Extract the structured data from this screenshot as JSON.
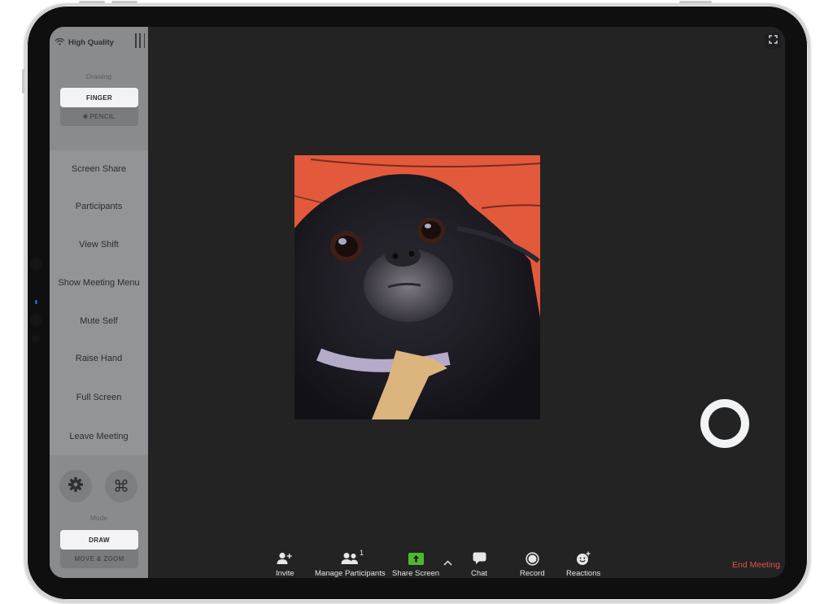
{
  "sidebar": {
    "connection": {
      "icon": "wifi-icon",
      "label": "High Quality"
    },
    "drawing": {
      "label": "Drawing",
      "options": [
        {
          "label": "FINGER",
          "selected": true
        },
        {
          "label": "PENCIL",
          "icon": "apple-icon",
          "selected": false
        }
      ]
    },
    "menu_items": [
      {
        "label": "Screen Share"
      },
      {
        "label": "Participants"
      },
      {
        "label": "View Shift"
      },
      {
        "label": "Show Meeting Menu"
      },
      {
        "label": "Mute Self"
      },
      {
        "label": "Raise Hand"
      },
      {
        "label": "Full Screen"
      },
      {
        "label": "Leave Meeting"
      }
    ],
    "shortcut_buttons": [
      {
        "icon": "gear-icon",
        "name": "settings"
      },
      {
        "icon": "command-icon",
        "name": "shortcuts"
      }
    ],
    "mode": {
      "label": "Mode",
      "options": [
        {
          "label": "DRAW",
          "selected": true
        },
        {
          "label": "MOVE & ZOOM",
          "selected": false
        }
      ]
    }
  },
  "stage": {
    "fullscreen_icon": "expand-icon",
    "video": {
      "subject": "dog-video-feed",
      "background": "#e25a3b"
    },
    "floating_button_icon": "ring-icon"
  },
  "toolbar": {
    "items": [
      {
        "label": "Invite",
        "icon": "add-person-icon"
      },
      {
        "label": "Manage Participants",
        "icon": "participants-icon",
        "badge": "1"
      },
      {
        "label": "Share Screen",
        "icon": "share-screen-icon",
        "accent": "#4cb82f"
      },
      {
        "label": "Chat",
        "icon": "chat-icon"
      },
      {
        "label": "Record",
        "icon": "record-icon"
      },
      {
        "label": "Reactions",
        "icon": "reactions-icon"
      }
    ],
    "share_options_icon": "chevron-up-icon",
    "end_meeting": {
      "label": "End Meeting",
      "color": "#e0524f"
    }
  }
}
